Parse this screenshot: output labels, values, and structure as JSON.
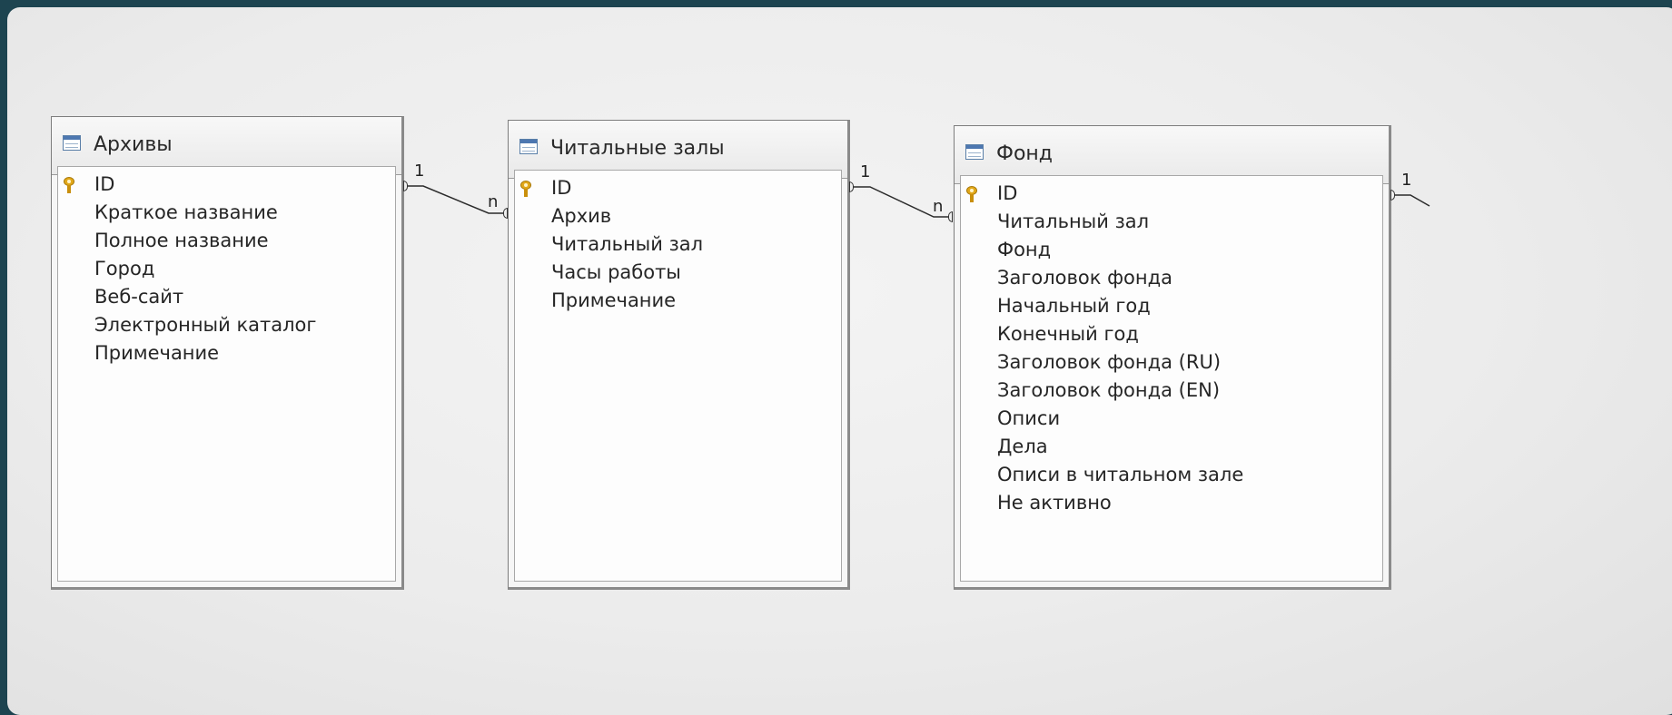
{
  "tables": [
    {
      "name": "Архивы",
      "fields": [
        "ID",
        "Краткое название",
        "Полное название",
        "Город",
        "Веб-сайт",
        "Электронный каталог",
        "Примечание"
      ],
      "primary_key": "ID"
    },
    {
      "name": "Читальные залы",
      "fields": [
        "ID",
        "Архив",
        "Читальный зал",
        "Часы работы",
        "Примечание"
      ],
      "primary_key": "ID"
    },
    {
      "name": "Фонд",
      "fields": [
        "ID",
        "Читальный зал",
        "Фонд",
        "Заголовок фонда",
        "Начальный год",
        "Конечный год",
        "Заголовок фонда (RU)",
        "Заголовок фонда (EN)",
        "Описи",
        "Дела",
        "Описи в читальном зале",
        "Не активно"
      ],
      "primary_key": "ID"
    }
  ],
  "relations": [
    {
      "from": "Архивы",
      "to": "Читальные залы",
      "from_card": "1",
      "to_card": "n"
    },
    {
      "from": "Читальные залы",
      "to": "Фонд",
      "from_card": "1",
      "to_card": "n"
    },
    {
      "from": "Фонд",
      "to": "",
      "from_card": "1",
      "to_card": ""
    }
  ],
  "icons": {
    "table": "table-icon",
    "primary_key": "key-icon"
  },
  "colors": {
    "background": "#1d4450",
    "canvas": "#ececec",
    "key": "#e2a81a",
    "table_icon": "#4d77b0"
  }
}
